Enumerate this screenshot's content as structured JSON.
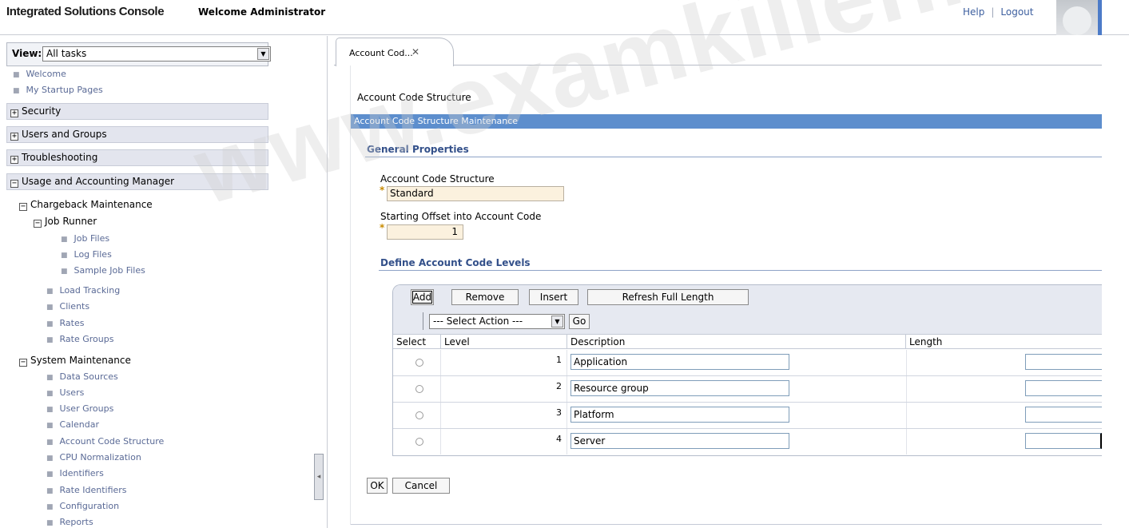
{
  "banner": {
    "title": "Integrated Solutions Console",
    "welcome": "Welcome Administrator",
    "help": "Help",
    "separator": "|",
    "logout": "Logout"
  },
  "nav": {
    "view_label": "View:",
    "view_value": "All tasks",
    "links": [
      "Welcome",
      "My Startup Pages"
    ],
    "sections": [
      "Security",
      "Users and Groups",
      "Troubleshooting",
      "Usage and Accounting Manager"
    ],
    "chargeback": "Chargeback Maintenance",
    "job_runner": "Job Runner",
    "job_runner_items": [
      "Job Files",
      "Log Files",
      "Sample Job Files"
    ],
    "chargeback_items": [
      "Load Tracking",
      "Clients",
      "Rates",
      "Rate Groups"
    ],
    "system_maintenance": "System Maintenance",
    "system_items": [
      "Data Sources",
      "Users",
      "User Groups",
      "Calendar",
      "Account Code Structure",
      "CPU Normalization",
      "Identifiers",
      "Rate Identifiers",
      "Configuration",
      "Reports"
    ],
    "plus": "+",
    "minus": "−"
  },
  "tab": {
    "label": "Account Cod...",
    "close": "✕"
  },
  "main": {
    "page_title": "Account Code Structure",
    "section_bar": "Account Code Structure Maintenance",
    "general_properties": "General Properties",
    "field1_label": "Account Code Structure",
    "field1_value": "Standard",
    "field2_label": "Starting Offset into Account Code",
    "field2_value": "1",
    "required_mark": "*",
    "define_levels": "Define Account Code Levels"
  },
  "table": {
    "buttons": {
      "add": "Add",
      "remove": "Remove",
      "insert": "Insert",
      "refresh": "Refresh Full Length",
      "go": "Go"
    },
    "select_action": "--- Select Action ---",
    "columns": [
      "Select",
      "Level",
      "Description",
      "Length"
    ],
    "rows": [
      {
        "level": "1",
        "description": "Application"
      },
      {
        "level": "2",
        "description": "Resource group"
      },
      {
        "level": "3",
        "description": "Platform"
      },
      {
        "level": "4",
        "description": "Server"
      }
    ]
  },
  "actions": {
    "ok": "OK",
    "cancel": "Cancel"
  },
  "watermark": "www.examkiller.net",
  "colors": {
    "section_bar": "#5d8ecd",
    "subhead": "#33508a",
    "required_input": "#fbf1de",
    "nav_section": "#e3e5ee"
  }
}
